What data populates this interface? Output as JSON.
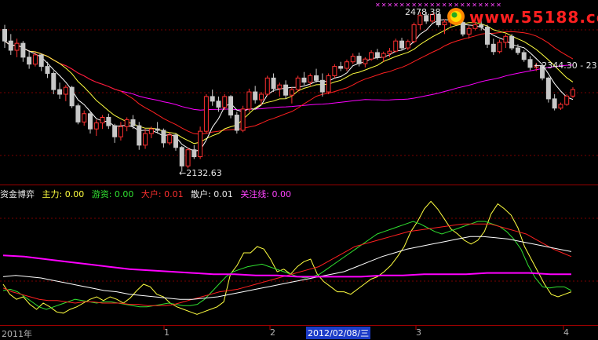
{
  "logo": {
    "text": "www.55188.com"
  },
  "stars": "✕✕✕✕✕✕✕✕✕✕✕✕✕✕✕✕✕✕✕✕✕",
  "annotations": {
    "high": "2478.38",
    "low": "←2132.63",
    "last": "←2344.30 - 23"
  },
  "legend": {
    "title": "资金博弈",
    "zhuli": "主力: 0.00",
    "youzi": "游资: 0.00",
    "dahu": "大户: 0.01",
    "sanhu": "散户: 0.01",
    "guanzhu": "关注线: 0.00"
  },
  "xaxis": {
    "start": "2011年",
    "m1": "1",
    "m2": "2",
    "selected": "2012/02/08/三",
    "m3": "3",
    "m4": "4"
  },
  "colors": {
    "up": "#ff3030",
    "down": "#c8c8c8",
    "ma5": "#ffffff",
    "ma10": "#ffff40",
    "ma20": "#ff2020",
    "ma60": "#ff00ff",
    "zhuli": "#ffff40",
    "youzi": "#30e030",
    "dahu": "#ff2020",
    "sanhu": "#ffffff",
    "guanzhu": "#ff00ff"
  },
  "chart_data": [
    {
      "type": "candlestick",
      "ylim": [
        2110,
        2490
      ],
      "candles": [
        [
          2440,
          2450,
          2400,
          2415
        ],
        [
          2415,
          2430,
          2385,
          2395
        ],
        [
          2395,
          2420,
          2380,
          2410
        ],
        [
          2410,
          2415,
          2370,
          2380
        ],
        [
          2380,
          2395,
          2355,
          2365
        ],
        [
          2365,
          2390,
          2360,
          2385
        ],
        [
          2385,
          2388,
          2350,
          2360
        ],
        [
          2360,
          2370,
          2335,
          2345
        ],
        [
          2345,
          2350,
          2300,
          2310
        ],
        [
          2310,
          2325,
          2290,
          2300
        ],
        [
          2300,
          2320,
          2285,
          2315
        ],
        [
          2315,
          2318,
          2270,
          2275
        ],
        [
          2275,
          2280,
          2235,
          2240
        ],
        [
          2240,
          2265,
          2232,
          2258
        ],
        [
          2258,
          2262,
          2215,
          2225
        ],
        [
          2225,
          2245,
          2210,
          2238
        ],
        [
          2238,
          2255,
          2225,
          2250
        ],
        [
          2250,
          2258,
          2225,
          2232
        ],
        [
          2232,
          2236,
          2195,
          2208
        ],
        [
          2208,
          2240,
          2200,
          2230
        ],
        [
          2230,
          2250,
          2220,
          2245
        ],
        [
          2245,
          2255,
          2225,
          2232
        ],
        [
          2232,
          2240,
          2180,
          2190
        ],
        [
          2190,
          2225,
          2182,
          2215
        ],
        [
          2215,
          2230,
          2205,
          2225
        ],
        [
          2225,
          2240,
          2215,
          2222
        ],
        [
          2222,
          2226,
          2185,
          2195
        ],
        [
          2195,
          2218,
          2190,
          2212
        ],
        [
          2212,
          2215,
          2178,
          2185
        ],
        [
          2185,
          2188,
          2133,
          2145
        ],
        [
          2145,
          2185,
          2140,
          2180
        ],
        [
          2180,
          2190,
          2160,
          2165
        ],
        [
          2165,
          2230,
          2160,
          2220
        ],
        [
          2220,
          2300,
          2215,
          2295
        ],
        [
          2295,
          2310,
          2275,
          2285
        ],
        [
          2285,
          2295,
          2262,
          2272
        ],
        [
          2272,
          2300,
          2266,
          2295
        ],
        [
          2295,
          2298,
          2248,
          2255
        ],
        [
          2255,
          2262,
          2215,
          2222
        ],
        [
          2222,
          2275,
          2218,
          2268
        ],
        [
          2268,
          2312,
          2262,
          2305
        ],
        [
          2305,
          2318,
          2280,
          2288
        ],
        [
          2288,
          2305,
          2276,
          2300
        ],
        [
          2300,
          2340,
          2296,
          2335
        ],
        [
          2335,
          2345,
          2305,
          2312
        ],
        [
          2312,
          2325,
          2295,
          2320
        ],
        [
          2320,
          2330,
          2290,
          2298
        ],
        [
          2298,
          2315,
          2280,
          2310
        ],
        [
          2310,
          2340,
          2305,
          2335
        ],
        [
          2335,
          2348,
          2320,
          2326
        ],
        [
          2326,
          2345,
          2318,
          2340
        ],
        [
          2340,
          2355,
          2325,
          2330
        ],
        [
          2330,
          2345,
          2295,
          2305
        ],
        [
          2305,
          2345,
          2300,
          2340
        ],
        [
          2340,
          2365,
          2335,
          2360
        ],
        [
          2360,
          2370,
          2350,
          2356
        ],
        [
          2356,
          2375,
          2350,
          2370
        ],
        [
          2370,
          2388,
          2365,
          2382
        ],
        [
          2382,
          2390,
          2360,
          2366
        ],
        [
          2366,
          2380,
          2358,
          2376
        ],
        [
          2376,
          2395,
          2372,
          2390
        ],
        [
          2390,
          2398,
          2375,
          2380
        ],
        [
          2380,
          2392,
          2370,
          2388
        ],
        [
          2388,
          2400,
          2380,
          2393
        ],
        [
          2393,
          2420,
          2390,
          2415
        ],
        [
          2415,
          2422,
          2395,
          2400
        ],
        [
          2400,
          2418,
          2395,
          2414
        ],
        [
          2414,
          2455,
          2410,
          2450
        ],
        [
          2450,
          2478,
          2440,
          2470
        ],
        [
          2470,
          2478,
          2452,
          2458
        ],
        [
          2458,
          2476,
          2454,
          2472
        ],
        [
          2472,
          2475,
          2445,
          2450
        ],
        [
          2450,
          2462,
          2430,
          2456
        ],
        [
          2456,
          2470,
          2446,
          2464
        ],
        [
          2464,
          2472,
          2450,
          2455
        ],
        [
          2455,
          2462,
          2425,
          2430
        ],
        [
          2430,
          2448,
          2420,
          2442
        ],
        [
          2442,
          2456,
          2438,
          2450
        ],
        [
          2450,
          2460,
          2438,
          2445
        ],
        [
          2445,
          2450,
          2400,
          2408
        ],
        [
          2408,
          2420,
          2385,
          2392
        ],
        [
          2392,
          2418,
          2388,
          2412
        ],
        [
          2412,
          2430,
          2400,
          2425
        ],
        [
          2425,
          2430,
          2395,
          2400
        ],
        [
          2400,
          2408,
          2385,
          2390
        ],
        [
          2390,
          2395,
          2370,
          2375
        ],
        [
          2375,
          2382,
          2352,
          2358
        ],
        [
          2358,
          2368,
          2350,
          2362
        ],
        [
          2362,
          2365,
          2330,
          2335
        ],
        [
          2335,
          2338,
          2282,
          2290
        ],
        [
          2290,
          2300,
          2265,
          2270
        ],
        [
          2270,
          2282,
          2266,
          2278
        ],
        [
          2278,
          2300,
          2275,
          2296
        ],
        [
          2296,
          2315,
          2292,
          2310
        ]
      ]
    },
    {
      "type": "line",
      "ylim": [
        0,
        1
      ],
      "series": [
        {
          "name": "主力",
          "color": "#ffff40",
          "values": [
            0.3,
            0.22,
            0.18,
            0.2,
            0.14,
            0.1,
            0.15,
            0.12,
            0.08,
            0.07,
            0.1,
            0.12,
            0.15,
            0.18,
            0.2,
            0.17,
            0.2,
            0.18,
            0.15,
            0.19,
            0.25,
            0.3,
            0.28,
            0.22,
            0.2,
            0.15,
            0.12,
            0.1,
            0.08,
            0.06,
            0.08,
            0.1,
            0.12,
            0.16,
            0.38,
            0.45,
            0.55,
            0.55,
            0.6,
            0.58,
            0.5,
            0.4,
            0.42,
            0.38,
            0.44,
            0.48,
            0.5,
            0.38,
            0.32,
            0.28,
            0.24,
            0.24,
            0.22,
            0.26,
            0.3,
            0.34,
            0.36,
            0.4,
            0.45,
            0.52,
            0.6,
            0.72,
            0.8,
            0.9,
            0.96,
            0.9,
            0.82,
            0.74,
            0.7,
            0.65,
            0.62,
            0.65,
            0.72,
            0.86,
            0.94,
            0.9,
            0.85,
            0.75,
            0.6,
            0.5,
            0.4,
            0.3,
            0.22,
            0.2,
            0.22,
            0.24
          ]
        },
        {
          "name": "游资",
          "color": "#30e030",
          "values": [
            0.25,
            0.26,
            0.24,
            0.2,
            0.16,
            0.12,
            0.1,
            0.12,
            0.14,
            0.16,
            0.18,
            0.17,
            0.16,
            0.15,
            0.16,
            0.16,
            0.15,
            0.14,
            0.13,
            0.12,
            0.12,
            0.13,
            0.14,
            0.15,
            0.14,
            0.13,
            0.13,
            0.14,
            0.18,
            0.24,
            0.3,
            0.36,
            0.4,
            0.42,
            0.44,
            0.45,
            0.46,
            0.44,
            0.42,
            0.4,
            0.38,
            0.36,
            0.35,
            0.36,
            0.38,
            0.42,
            0.46,
            0.5,
            0.54,
            0.58,
            0.62,
            0.66,
            0.7,
            0.72,
            0.74,
            0.76,
            0.78,
            0.8,
            0.78,
            0.75,
            0.72,
            0.7,
            0.72,
            0.74,
            0.76,
            0.78,
            0.8,
            0.8,
            0.78,
            0.76,
            0.72,
            0.66,
            0.58,
            0.45,
            0.35,
            0.28,
            0.27,
            0.28,
            0.28,
            0.25
          ]
        },
        {
          "name": "大户",
          "color": "#ff2020",
          "values": [
            0.27,
            0.24,
            0.22,
            0.2,
            0.18,
            0.17,
            0.17,
            0.16,
            0.15,
            0.16,
            0.16,
            0.15,
            0.15,
            0.15,
            0.14,
            0.14,
            0.13,
            0.13,
            0.13,
            0.14,
            0.16,
            0.18,
            0.2,
            0.22,
            0.24,
            0.25,
            0.26,
            0.28,
            0.3,
            0.32,
            0.34,
            0.36,
            0.38,
            0.4,
            0.42,
            0.44,
            0.48,
            0.52,
            0.56,
            0.6,
            0.62,
            0.64,
            0.66,
            0.68,
            0.7,
            0.72,
            0.73,
            0.74,
            0.75,
            0.76,
            0.77,
            0.78,
            0.78,
            0.78,
            0.78,
            0.76,
            0.74,
            0.72,
            0.7,
            0.66,
            0.62,
            0.58,
            0.55,
            0.52
          ]
        },
        {
          "name": "散户",
          "color": "#ffffff",
          "values": [
            0.36,
            0.37,
            0.36,
            0.35,
            0.33,
            0.31,
            0.29,
            0.27,
            0.25,
            0.24,
            0.22,
            0.21,
            0.2,
            0.19,
            0.18,
            0.18,
            0.19,
            0.2,
            0.22,
            0.24,
            0.26,
            0.28,
            0.3,
            0.32,
            0.34,
            0.36,
            0.38,
            0.4,
            0.44,
            0.48,
            0.52,
            0.55,
            0.58,
            0.6,
            0.62,
            0.64,
            0.66,
            0.68,
            0.68,
            0.67,
            0.66,
            0.64,
            0.62,
            0.6,
            0.58,
            0.56
          ]
        },
        {
          "name": "关注线",
          "color": "#ff00ff",
          "values": [
            0.53,
            0.52,
            0.5,
            0.48,
            0.46,
            0.44,
            0.42,
            0.41,
            0.4,
            0.39,
            0.38,
            0.38,
            0.37,
            0.37,
            0.36,
            0.36,
            0.36,
            0.36,
            0.37,
            0.37,
            0.38,
            0.38,
            0.38,
            0.39,
            0.39,
            0.39,
            0.38,
            0.38
          ]
        }
      ]
    }
  ]
}
